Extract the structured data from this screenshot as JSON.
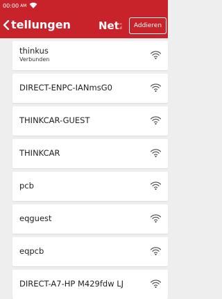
{
  "status_bar": {
    "time": "00:00",
    "ampm": "AM",
    "wifi_icon": "wifi-icon"
  },
  "header": {
    "back_icon": "chevron-left-icon",
    "title": "tellungen",
    "tab_label": "Netz",
    "add_label": "Addieren",
    "color": "#c8232b"
  },
  "networks": [
    {
      "name": "thinkus",
      "status": "Verbunden",
      "icon": "wifi-icon"
    },
    {
      "name": "DIRECT-ENPC-IANmsG0",
      "status": "",
      "icon": "wifi-icon"
    },
    {
      "name": "THINKCAR-GUEST",
      "status": "",
      "icon": "wifi-icon"
    },
    {
      "name": "THINKCAR",
      "status": "",
      "icon": "wifi-icon"
    },
    {
      "name": "pcb",
      "status": "",
      "icon": "wifi-icon"
    },
    {
      "name": "eqguest",
      "status": "",
      "icon": "wifi-icon"
    },
    {
      "name": "eqpcb",
      "status": "",
      "icon": "wifi-icon"
    },
    {
      "name": "DIRECT-A7-HP M429fdw LJ",
      "status": "",
      "icon": "wifi-icon"
    }
  ]
}
